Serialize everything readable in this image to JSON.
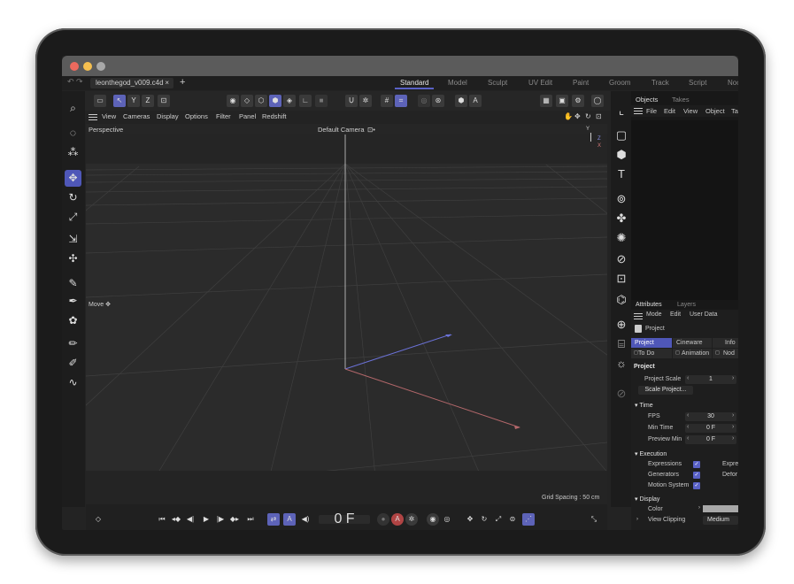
{
  "window": {
    "file_tab": "leonthegod_v009.c4d",
    "close": "×",
    "new_tab": "+"
  },
  "layouts": [
    "Standard",
    "Model",
    "Sculpt",
    "UV Edit",
    "Paint",
    "Groom",
    "Track",
    "Script",
    "Noc"
  ],
  "toolbar": {
    "axis_x": "X",
    "axis_y": "Y",
    "axis_z": "Z"
  },
  "viewport_menu": [
    "View",
    "Cameras",
    "Display",
    "Options",
    "Filter",
    "Panel",
    "Redshift"
  ],
  "viewport": {
    "name": "Perspective",
    "camera": "Default Camera",
    "camera_icon": "⊡•",
    "move_label": "Move",
    "grid_spacing": "Grid Spacing : 50 cm",
    "gizmo_y": "Y",
    "gizmo_z": "Z",
    "gizmo_x": "X"
  },
  "timeline": {
    "frame": "0 F"
  },
  "objects_panel": {
    "tabs": [
      "Objects",
      "Takes"
    ],
    "menu": [
      "File",
      "Edit",
      "View",
      "Object",
      "Ta"
    ]
  },
  "attributes_panel": {
    "tabs": [
      "Attributes",
      "Layers"
    ],
    "menu": [
      "Mode",
      "Edit",
      "User Data"
    ],
    "object_name": "Project",
    "subtabs": [
      "Project",
      "Cineware",
      "Info"
    ],
    "subtabs2": [
      "To Do",
      "Animation",
      "Nod"
    ],
    "section_title": "Project",
    "project_scale_label": "Project Scale",
    "project_scale_value": "1",
    "scale_button": "Scale Project...",
    "time_section": "Time",
    "fps_label": "FPS",
    "fps_value": "30",
    "min_time_label": "Min Time",
    "min_time_value": "0 F",
    "preview_min_label": "Preview Min",
    "preview_min_value": "0 F",
    "execution_section": "Execution",
    "expressions_label": "Expressions",
    "generators_label": "Generators",
    "deformers_label": "Deformers",
    "motion_system_label": "Motion System",
    "expre": "Expre",
    "defor": "Defor",
    "display_section": "Display",
    "color_label": "Color",
    "view_clipping_label": "View Clipping",
    "view_clipping_value": "Medium"
  },
  "colors": {
    "accent": "#5961c6",
    "traffic_red": "#ed6a5e",
    "traffic_yellow": "#f5bf4f",
    "traffic_gray": "#a8a8a8"
  }
}
